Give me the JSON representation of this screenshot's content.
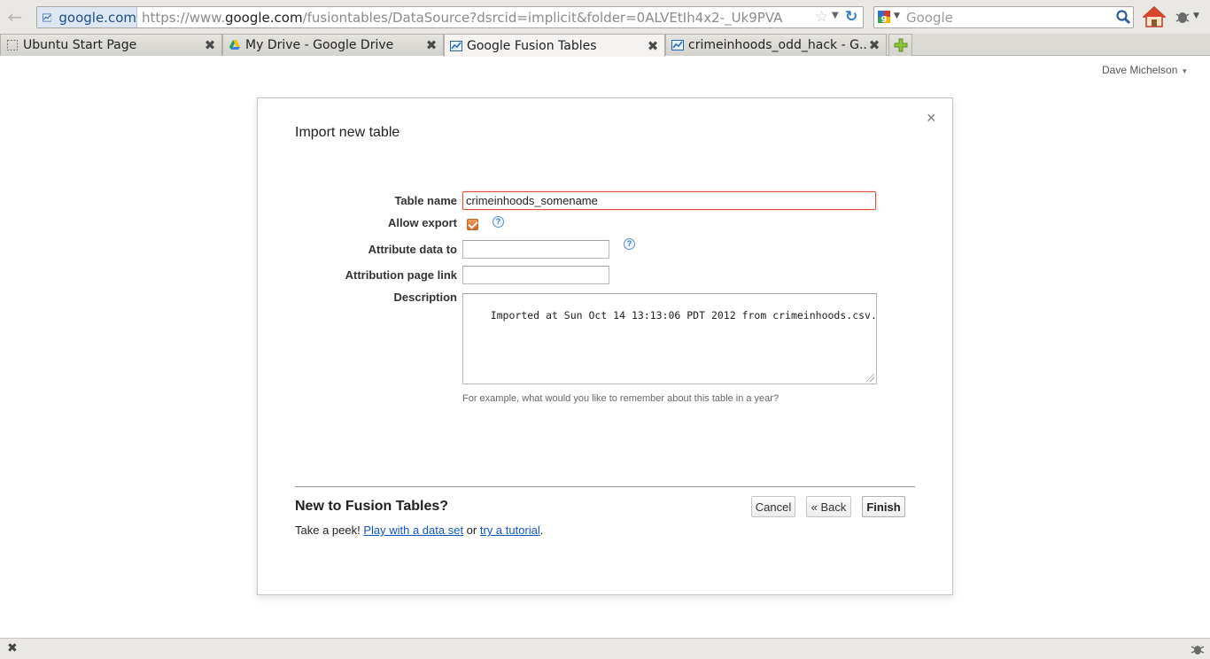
{
  "browser": {
    "site_identity": "google.com",
    "url_prefix": "https://www.",
    "url_domain": "google.com",
    "url_path": "/fusiontables/DataSource?dsrcid=implicit&folder=0ALVEtIh4x2-_Uk9PVA",
    "search_placeholder": "Google",
    "tabs": [
      {
        "title": "Ubuntu Start Page",
        "icon": "blank-page-icon"
      },
      {
        "title": "My Drive - Google Drive",
        "icon": "google-drive-icon"
      },
      {
        "title": "Google Fusion Tables",
        "icon": "fusion-tables-icon"
      },
      {
        "title": "crimeinhoods_odd_hack - G...",
        "icon": "fusion-tables-icon"
      }
    ],
    "active_tab_index": 2
  },
  "page": {
    "user_name": "Dave Michelson"
  },
  "dialog": {
    "title": "Import new table",
    "close_glyph": "×",
    "labels": {
      "table_name": "Table name",
      "allow_export": "Allow export",
      "attribute_data_to": "Attribute data to",
      "attribution_page_link": "Attribution page link",
      "description": "Description"
    },
    "values": {
      "table_name": "crimeinhoods_somename",
      "allow_export": true,
      "attribute_data_to": "",
      "attribution_page_link": "",
      "description": "Imported at Sun Oct 14 13:13:06 PDT 2012 from crimeinhoods.csv."
    },
    "description_hint": "For example, what would you like to remember about this table in a year?",
    "footer": {
      "heading": "New to Fusion Tables?",
      "peek_prefix": "Take a peek! ",
      "link_dataset": "Play with a data set",
      "peek_or": " or ",
      "link_tutorial": "try a tutorial",
      "peek_suffix": "."
    },
    "buttons": {
      "cancel": "Cancel",
      "back": "« Back",
      "finish": "Finish"
    }
  },
  "colors": {
    "focus_border": "#dd4b39",
    "link": "#1155cc",
    "checkbox": "#e07a33",
    "help_icon": "#3b78c9"
  }
}
